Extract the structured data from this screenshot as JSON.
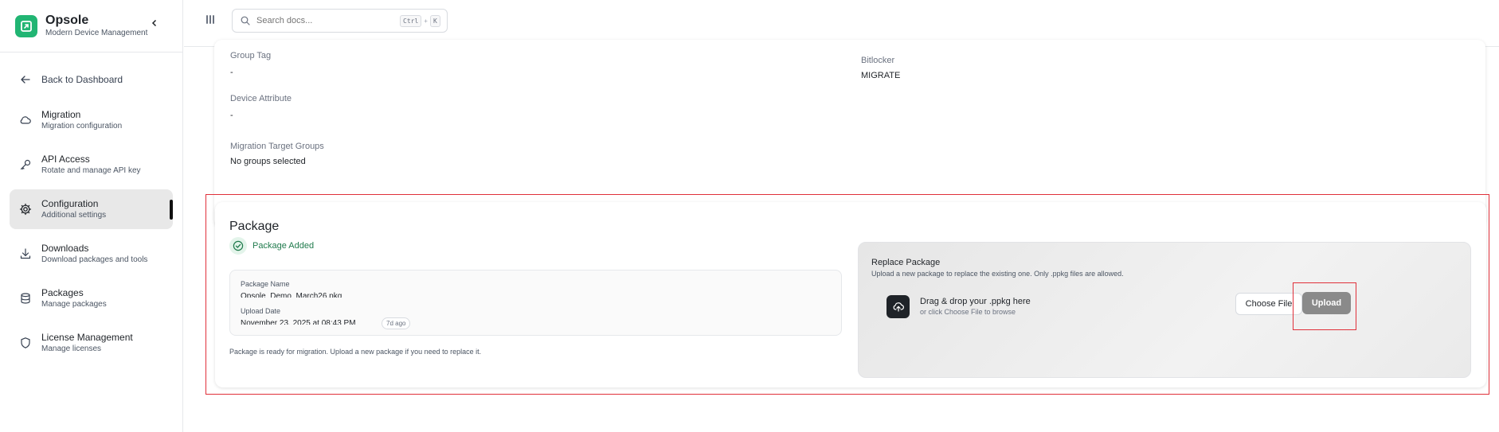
{
  "app": {
    "name": "Opsole",
    "tagline": "Modern Device Management",
    "accent_color": "#21b573"
  },
  "sidebar": {
    "back": {
      "label": "Back to Dashboard",
      "icon": "arrow-left-icon"
    },
    "items": [
      {
        "title": "Migration",
        "subtitle": "Migration configuration",
        "icon": "cloud-icon",
        "active": false
      },
      {
        "title": "API Access",
        "subtitle": "Rotate and manage API key",
        "icon": "key-icon",
        "active": false
      },
      {
        "title": "Configuration",
        "subtitle": "Additional settings",
        "icon": "gear-icon",
        "active": true
      },
      {
        "title": "Downloads",
        "subtitle": "Download packages and tools",
        "icon": "download-icon",
        "active": false
      },
      {
        "title": "Packages",
        "subtitle": "Manage packages",
        "icon": "database-icon",
        "active": false
      },
      {
        "title": "License Management",
        "subtitle": "Manage licenses",
        "icon": "shield-icon",
        "active": false
      }
    ]
  },
  "topbar": {
    "search_placeholder": "Search docs...",
    "shortcut_key1": "Ctrl",
    "shortcut_plus": "+",
    "shortcut_key2": "K"
  },
  "config": {
    "group_tag_label": "Group Tag",
    "group_tag_value": "-",
    "bitlocker_label": "Bitlocker",
    "bitlocker_value": "MIGRATE",
    "device_attribute_label": "Device Attribute",
    "device_attribute_value": "-",
    "target_groups_label": "Migration Target Groups",
    "target_groups_value": "No groups selected"
  },
  "package": {
    "title": "Package",
    "status": "Package Added",
    "name_label": "Package Name",
    "name_value": "Opsole_Demo_March26.pkg",
    "upload_date_label": "Upload Date",
    "upload_date_value": "November 23, 2025 at 08:43 PM",
    "ago": "7d ago",
    "footer_note": "Package is ready for migration. Upload a new package if you need to replace it."
  },
  "replace": {
    "title": "Replace Package",
    "subtitle": "Upload a new package to replace the existing one. Only .ppkg files are allowed.",
    "drop_title": "Drag & drop your .ppkg here",
    "drop_subtitle": "or click Choose File to browse",
    "choose_label": "Choose File",
    "upload_label": "Upload"
  }
}
